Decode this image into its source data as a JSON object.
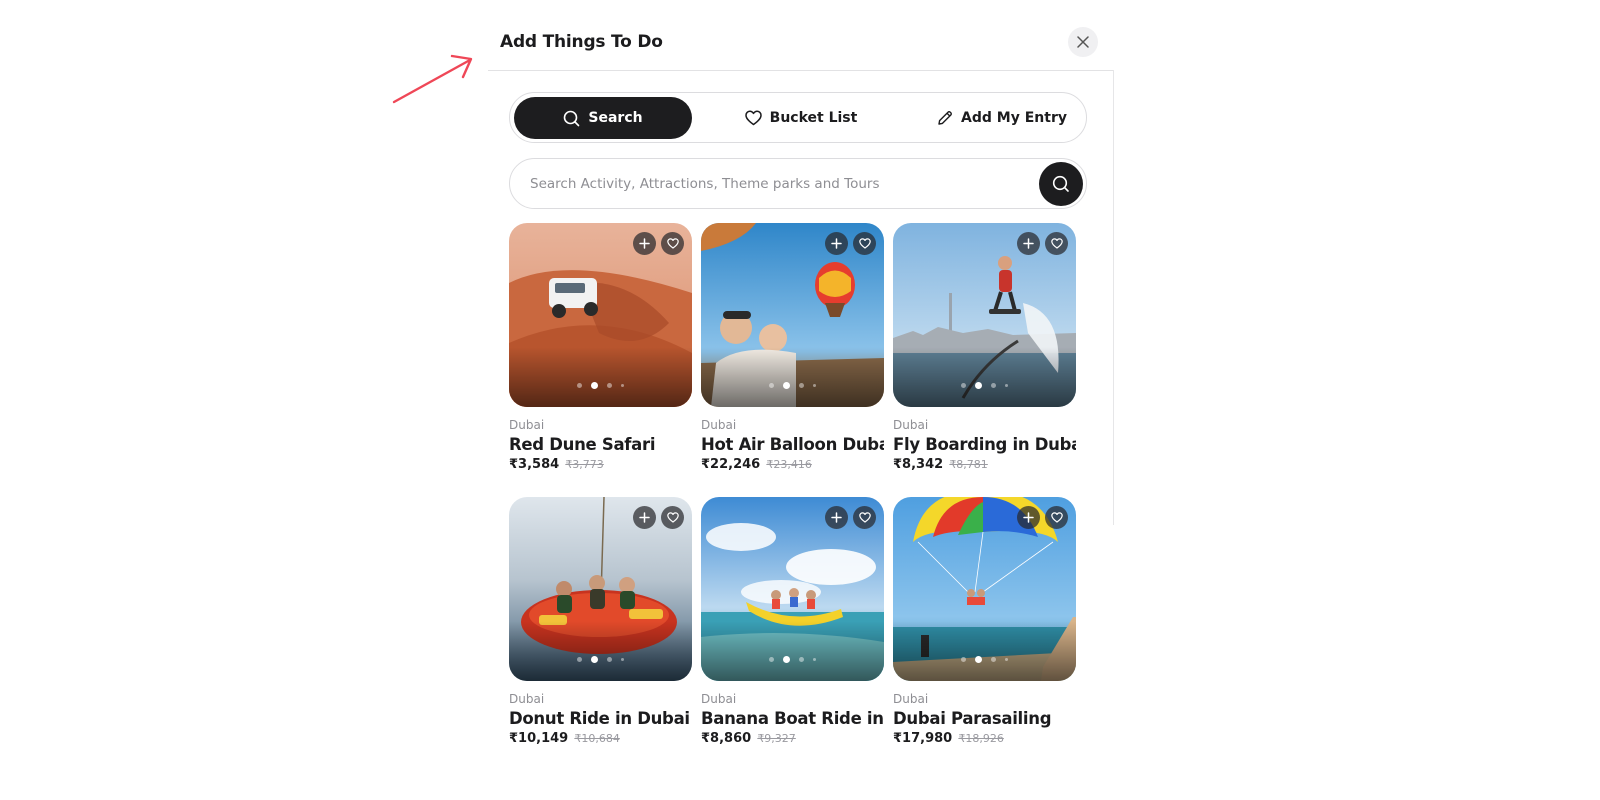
{
  "modal": {
    "title": "Add Things To Do",
    "close_icon": "close-icon"
  },
  "accent_arrow_color": "#ef4757",
  "tabs": [
    {
      "label": "Search",
      "icon": "search-icon",
      "active": true
    },
    {
      "label": "Bucket List",
      "icon": "heart-icon",
      "active": false
    },
    {
      "label": "Add My Entry",
      "icon": "pencil-icon",
      "active": false
    }
  ],
  "search": {
    "value": "",
    "placeholder": "Search Activity, Attractions, Theme parks and Tours",
    "button_icon": "search-icon"
  },
  "activities": [
    {
      "city": "Dubai",
      "title": "Red Dune Safari",
      "price": "₹3,584",
      "original_price": "₹3,773"
    },
    {
      "city": "Dubai",
      "title": "Hot Air Balloon Dubai",
      "price": "₹22,246",
      "original_price": "₹23,416"
    },
    {
      "city": "Dubai",
      "title": "Fly Boarding in Dubai",
      "price": "₹8,342",
      "original_price": "₹8,781"
    },
    {
      "city": "Dubai",
      "title": "Donut Ride in Dubai",
      "price": "₹10,149",
      "original_price": "₹10,684"
    },
    {
      "city": "Dubai",
      "title": "Banana Boat Ride in...",
      "price": "₹8,860",
      "original_price": "₹9,327"
    },
    {
      "city": "Dubai",
      "title": "Dubai Parasailing",
      "price": "₹17,980",
      "original_price": "₹18,926"
    }
  ],
  "carousel": {
    "slides": 4,
    "active_slide": 2
  }
}
